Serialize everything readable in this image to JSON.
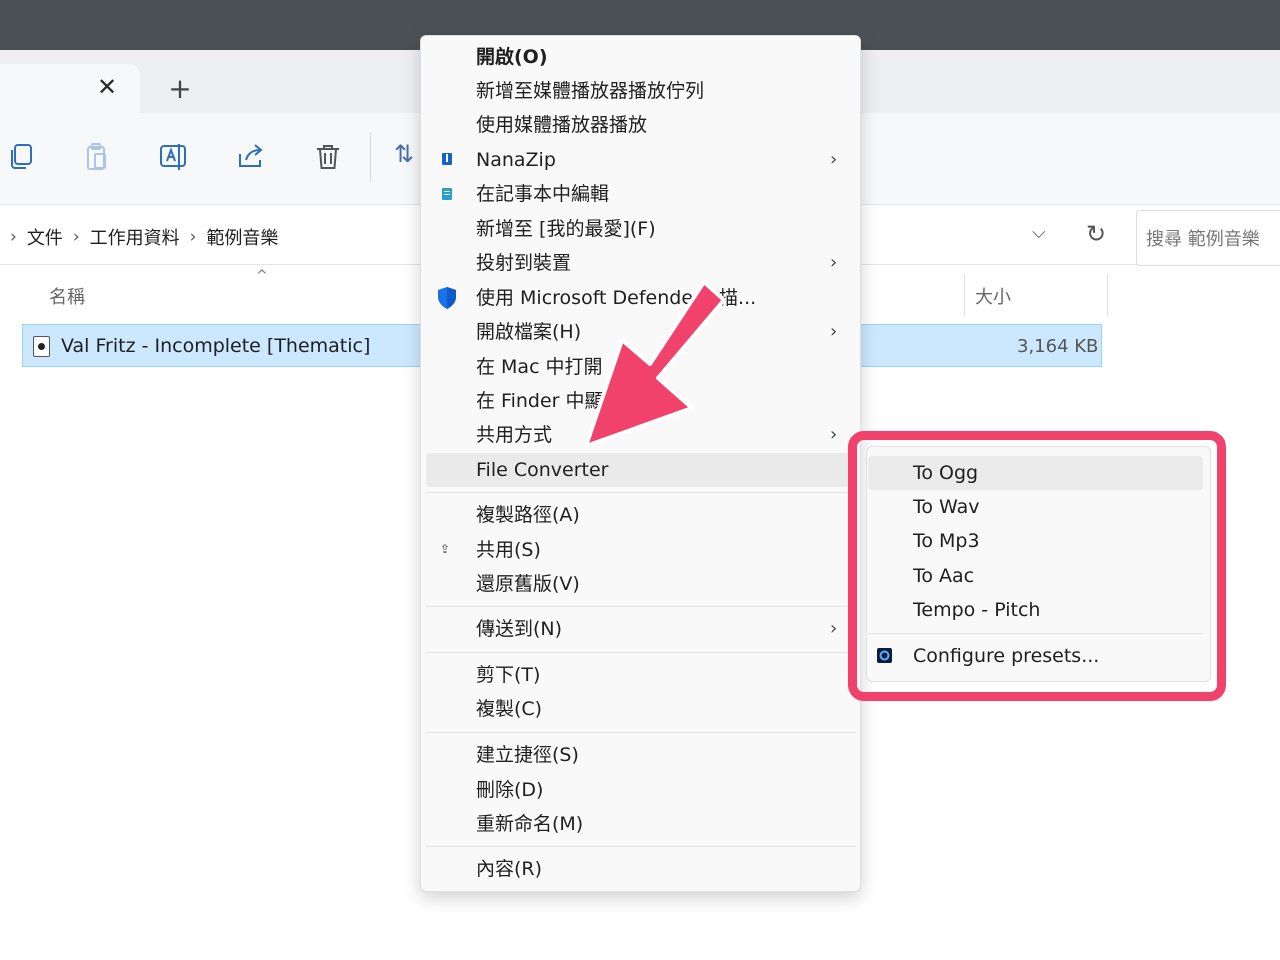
{
  "explorer": {
    "tab_close": "✕",
    "tab_new": "+",
    "breadcrumb": [
      "文件",
      "工作用資料",
      "範例音樂"
    ],
    "breadcrumb_sep": "›",
    "search_placeholder": "搜尋 範例音樂",
    "columns": {
      "name": "名稱",
      "size": "大小"
    },
    "file": {
      "name": "Val Fritz - Incomplete [Thematic]",
      "size": "3,164 KB"
    }
  },
  "context_menu": {
    "items": [
      {
        "label": "開啟(O)",
        "bold": true
      },
      {
        "label": "新增至媒體播放器播放佇列"
      },
      {
        "label": "使用媒體播放器播放"
      },
      {
        "label": "NanaZip",
        "submenu": true,
        "icon": "nanazip-icon"
      },
      {
        "label": "在記事本中編輯",
        "icon": "notepad-icon"
      },
      {
        "label": "新增至 [我的最愛](F)"
      },
      {
        "label": "投射到裝置",
        "submenu": true
      },
      {
        "label": "使用 Microsoft Defende",
        "label_tail": "描...",
        "icon": "defender-shield-icon"
      },
      {
        "label": "開啟檔案(H)",
        "submenu": true
      },
      {
        "label": "在 Mac 中打開"
      },
      {
        "label": "在 Finder 中顯"
      },
      {
        "label": "共用方式",
        "submenu": true
      },
      {
        "label": "File Converter",
        "submenu": true,
        "highlighted": true
      },
      {
        "label": "複製路徑(A)"
      },
      {
        "label": "共用(S)",
        "icon": "share-icon"
      },
      {
        "label": "還原舊版(V)"
      },
      {
        "label": "傳送到(N)",
        "submenu": true
      },
      {
        "label": "剪下(T)"
      },
      {
        "label": "複製(C)"
      },
      {
        "label": "建立捷徑(S)"
      },
      {
        "label": "刪除(D)"
      },
      {
        "label": "重新命名(M)"
      },
      {
        "label": "內容(R)"
      }
    ],
    "chevron": "›"
  },
  "file_converter_submenu": {
    "items": [
      "To Ogg",
      "To Wav",
      "To Mp3",
      "To Aac",
      "Tempo - Pitch"
    ],
    "configure": "Configure presets..."
  },
  "colors": {
    "highlight_frame": "#f0426a",
    "selection": "#cce8ff",
    "accent": "#0b6cbd"
  }
}
